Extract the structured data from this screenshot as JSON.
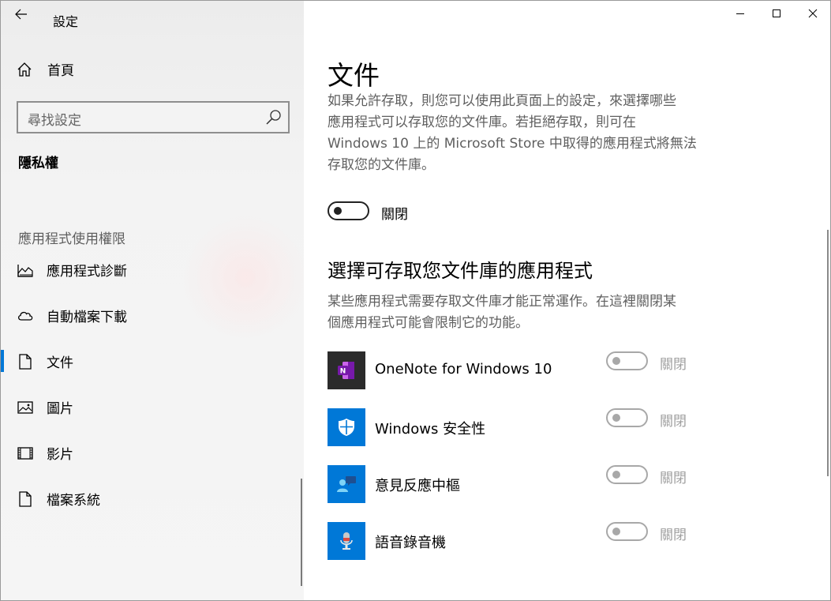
{
  "window": {
    "title": "設定"
  },
  "sidebar": {
    "home_label": "首頁",
    "search_placeholder": "尋找設定",
    "section_title": "隱私權",
    "group_title": "應用程式使用權限",
    "items": [
      {
        "label": "應用程式診斷",
        "icon": "diagnostics-icon"
      },
      {
        "label": "自動檔案下載",
        "icon": "cloud-icon"
      },
      {
        "label": "文件",
        "icon": "document-icon",
        "active": true
      },
      {
        "label": "圖片",
        "icon": "picture-icon"
      },
      {
        "label": "影片",
        "icon": "video-icon"
      },
      {
        "label": "檔案系統",
        "icon": "file-icon"
      }
    ]
  },
  "main": {
    "title": "文件",
    "description": "如果允許存取，則您可以使用此頁面上的設定，來選擇哪些應用程式可以存取您的文件庫。若拒絕存取，則可在 Windows 10 上的 Microsoft Store 中取得的應用程式將無法存取您的文件庫。",
    "desc_lines": [
      "如果允許存取，則您可以使用此頁面上的設定，來選擇哪些",
      "應用程式可以存取您的文件庫。若拒絕存取，則可在",
      "Windows 10 上的 Microsoft Store 中取得的應用程式將無法",
      "存取您的文件庫。"
    ],
    "master_toggle": {
      "state_label": "關閉",
      "on": false
    },
    "apps_heading": "選擇可存取您文件庫的應用程式",
    "apps_desc_lines": [
      "某些應用程式需要存取文件庫才能正常運作。在這裡關閉某",
      "個應用程式可能會限制它的功能。"
    ],
    "apps": [
      {
        "name": "OneNote for Windows 10",
        "state_label": "關閉",
        "icon": "onenote-icon",
        "tile_color": "#2b2b2b"
      },
      {
        "name": "Windows 安全性",
        "state_label": "關閉",
        "icon": "shield-icon",
        "tile_color": "#0078d7"
      },
      {
        "name": "意見反應中樞",
        "state_label": "關閉",
        "icon": "feedback-icon",
        "tile_color": "#0078d7"
      },
      {
        "name": "語音錄音機",
        "state_label": "關閉",
        "icon": "microphone-icon",
        "tile_color": "#0078d7"
      }
    ]
  },
  "colors": {
    "accent": "#0078d7",
    "secondary_text": "#5f5f5f",
    "disabled": "#a8a8a8"
  }
}
